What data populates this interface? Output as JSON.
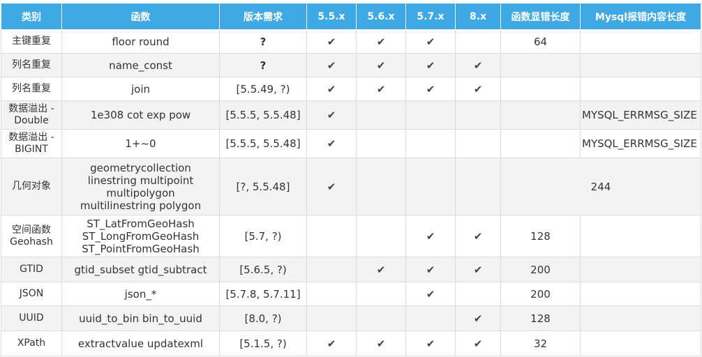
{
  "table": {
    "headers": [
      "类别",
      "函数",
      "版本需求",
      "5.5.x",
      "5.6.x",
      "5.7.x",
      "8.x",
      "函数显错长度",
      "Mysql报错内容长度"
    ],
    "check_symbol": "✔",
    "rows": [
      {
        "category": "主键重复",
        "functions": [
          "floor round"
        ],
        "version": "?",
        "v55": true,
        "v56": true,
        "v57": true,
        "v8": false,
        "func_len": "64",
        "msg_len": ""
      },
      {
        "category": "列名重复",
        "functions": [
          "name_const"
        ],
        "version": "?",
        "v55": true,
        "v56": true,
        "v57": true,
        "v8": true,
        "func_len": "",
        "msg_len": ""
      },
      {
        "category": "列名重复",
        "functions": [
          "join"
        ],
        "version": "[5.5.49, ?)",
        "v55": true,
        "v56": true,
        "v57": true,
        "v8": true,
        "func_len": "",
        "msg_len": ""
      },
      {
        "category": "数据溢出 - Double",
        "functions": [
          "1e308 cot exp pow"
        ],
        "version": "[5.5.5, 5.5.48]",
        "v55": true,
        "v56": false,
        "v57": false,
        "v8": false,
        "func_len": "",
        "msg_len": "MYSQL_ERRMSG_SIZE"
      },
      {
        "category": "数据溢出 - BIGINT",
        "functions": [
          "1+~0"
        ],
        "version": "[5.5.5, 5.5.48]",
        "v55": true,
        "v56": false,
        "v57": false,
        "v8": false,
        "func_len": "",
        "msg_len": "MYSQL_ERRMSG_SIZE"
      },
      {
        "category": "几何对象",
        "functions": [
          "geometrycollection",
          "linestring multipoint",
          "multipolygon",
          "multilinestring polygon"
        ],
        "version": "[?, 5.5.48]",
        "v55": true,
        "v56": false,
        "v57": false,
        "v8": false,
        "merged_len": "244"
      },
      {
        "category": "空间函数 Geohash",
        "functions": [
          "ST_LatFromGeoHash",
          "ST_LongFromGeoHash",
          "ST_PointFromGeoHash"
        ],
        "version": "[5.7, ?)",
        "v55": false,
        "v56": false,
        "v57": true,
        "v8": true,
        "func_len": "128",
        "msg_len": ""
      },
      {
        "category": "GTID",
        "functions": [
          "gtid_subset gtid_subtract"
        ],
        "version": "[5.6.5, ?)",
        "v55": false,
        "v56": true,
        "v57": true,
        "v8": true,
        "func_len": "200",
        "msg_len": ""
      },
      {
        "category": "JSON",
        "functions": [
          "json_*"
        ],
        "version": "[5.7.8, 5.7.11]",
        "v55": false,
        "v56": false,
        "v57": true,
        "v8": false,
        "func_len": "200",
        "msg_len": ""
      },
      {
        "category": "UUID",
        "functions": [
          "uuid_to_bin bin_to_uuid"
        ],
        "version": "[8.0, ?)",
        "v55": false,
        "v56": false,
        "v57": false,
        "v8": true,
        "func_len": "128",
        "msg_len": ""
      },
      {
        "category": "XPath",
        "functions": [
          "extractvalue updatexml"
        ],
        "version": "[5.1.5, ?)",
        "v55": true,
        "v56": true,
        "v57": true,
        "v8": true,
        "func_len": "32",
        "msg_len": ""
      }
    ]
  },
  "colors": {
    "header_bg": "#3fa9e6",
    "header_text": "#ffffff",
    "row_alt": "#f3f3f3",
    "border": "#dcdcdc"
  }
}
